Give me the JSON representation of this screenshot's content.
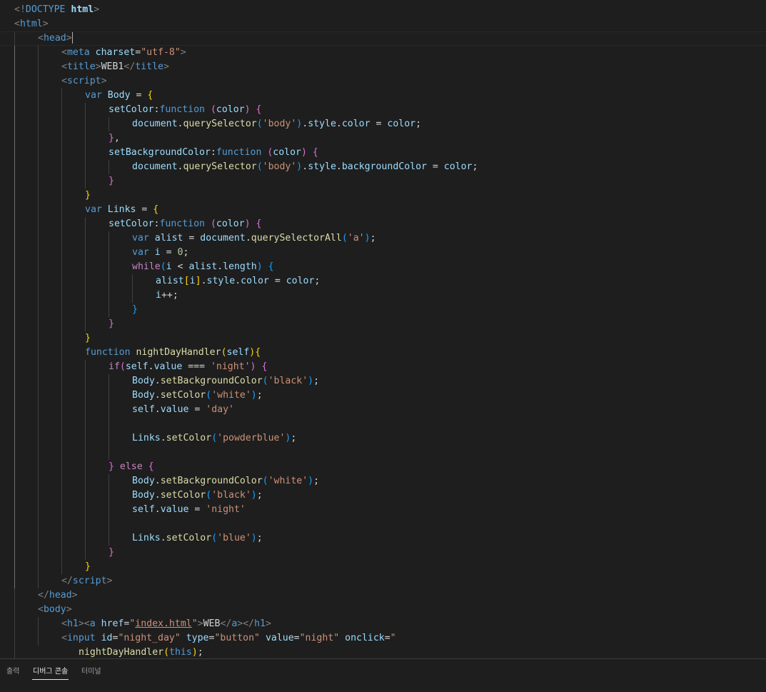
{
  "editor": {
    "lines": [
      {
        "indent": 0,
        "tokens": [
          [
            "t-punct",
            "<!"
          ],
          [
            "t-tag",
            "DOCTYPE "
          ],
          [
            "t-attr t-bold",
            "html"
          ],
          [
            "t-punct",
            ">"
          ]
        ]
      },
      {
        "indent": 0,
        "tokens": [
          [
            "t-punct",
            "<"
          ],
          [
            "t-tag",
            "html"
          ],
          [
            "t-punct",
            ">"
          ]
        ]
      },
      {
        "indent": 1,
        "current": true,
        "cursor": true,
        "tokens": [
          [
            "t-punct",
            "<"
          ],
          [
            "t-tag",
            "head"
          ],
          [
            "t-punct",
            ">"
          ]
        ]
      },
      {
        "indent": 2,
        "tokens": [
          [
            "t-punct",
            "<"
          ],
          [
            "t-tag",
            "meta "
          ],
          [
            "t-attr",
            "charset"
          ],
          [
            "t-text",
            "="
          ],
          [
            "t-str",
            "\"utf-8\""
          ],
          [
            "t-punct",
            ">"
          ]
        ]
      },
      {
        "indent": 2,
        "tokens": [
          [
            "t-punct",
            "<"
          ],
          [
            "t-tag",
            "title"
          ],
          [
            "t-punct",
            ">"
          ],
          [
            "t-text",
            "WEB1"
          ],
          [
            "t-punct",
            "</"
          ],
          [
            "t-tag",
            "title"
          ],
          [
            "t-punct",
            ">"
          ]
        ]
      },
      {
        "indent": 2,
        "tokens": [
          [
            "t-punct",
            "<"
          ],
          [
            "t-tag",
            "script"
          ],
          [
            "t-punct",
            ">"
          ]
        ]
      },
      {
        "indent": 3,
        "tokens": [
          [
            "t-kw",
            "var "
          ],
          [
            "t-var",
            "Body"
          ],
          [
            "t-text",
            " = "
          ],
          [
            "t-b1",
            "{"
          ]
        ]
      },
      {
        "indent": 4,
        "tokens": [
          [
            "t-var",
            "setColor"
          ],
          [
            "t-text",
            ":"
          ],
          [
            "t-kw",
            "function "
          ],
          [
            "t-b2",
            "("
          ],
          [
            "t-var",
            "color"
          ],
          [
            "t-b2",
            ")"
          ],
          [
            "t-text",
            " "
          ],
          [
            "t-b2",
            "{"
          ]
        ]
      },
      {
        "indent": 5,
        "tokens": [
          [
            "t-var",
            "document"
          ],
          [
            "t-text",
            "."
          ],
          [
            "t-fn",
            "querySelector"
          ],
          [
            "t-b3",
            "("
          ],
          [
            "t-str",
            "'body'"
          ],
          [
            "t-b3",
            ")"
          ],
          [
            "t-text",
            "."
          ],
          [
            "t-var",
            "style"
          ],
          [
            "t-text",
            "."
          ],
          [
            "t-var",
            "color"
          ],
          [
            "t-text",
            " = "
          ],
          [
            "t-var",
            "color"
          ],
          [
            "t-text",
            ";"
          ]
        ]
      },
      {
        "indent": 4,
        "tokens": [
          [
            "t-b2",
            "}"
          ],
          [
            "t-text",
            ","
          ]
        ]
      },
      {
        "indent": 4,
        "tokens": [
          [
            "t-var",
            "setBackgroundColor"
          ],
          [
            "t-text",
            ":"
          ],
          [
            "t-kw",
            "function "
          ],
          [
            "t-b2",
            "("
          ],
          [
            "t-var",
            "color"
          ],
          [
            "t-b2",
            ")"
          ],
          [
            "t-text",
            " "
          ],
          [
            "t-b2",
            "{"
          ]
        ]
      },
      {
        "indent": 5,
        "tokens": [
          [
            "t-var",
            "document"
          ],
          [
            "t-text",
            "."
          ],
          [
            "t-fn",
            "querySelector"
          ],
          [
            "t-b3",
            "("
          ],
          [
            "t-str",
            "'body'"
          ],
          [
            "t-b3",
            ")"
          ],
          [
            "t-text",
            "."
          ],
          [
            "t-var",
            "style"
          ],
          [
            "t-text",
            "."
          ],
          [
            "t-var",
            "backgroundColor"
          ],
          [
            "t-text",
            " = "
          ],
          [
            "t-var",
            "color"
          ],
          [
            "t-text",
            ";"
          ]
        ]
      },
      {
        "indent": 4,
        "tokens": [
          [
            "t-b2",
            "}"
          ]
        ]
      },
      {
        "indent": 3,
        "tokens": [
          [
            "t-b1",
            "}"
          ]
        ]
      },
      {
        "indent": 3,
        "tokens": [
          [
            "t-kw",
            "var "
          ],
          [
            "t-var",
            "Links"
          ],
          [
            "t-text",
            " = "
          ],
          [
            "t-b1",
            "{"
          ]
        ]
      },
      {
        "indent": 4,
        "tokens": [
          [
            "t-var",
            "setColor"
          ],
          [
            "t-text",
            ":"
          ],
          [
            "t-kw",
            "function "
          ],
          [
            "t-b2",
            "("
          ],
          [
            "t-var",
            "color"
          ],
          [
            "t-b2",
            ")"
          ],
          [
            "t-text",
            " "
          ],
          [
            "t-b2",
            "{"
          ]
        ]
      },
      {
        "indent": 5,
        "tokens": [
          [
            "t-kw",
            "var "
          ],
          [
            "t-var",
            "alist"
          ],
          [
            "t-text",
            " = "
          ],
          [
            "t-var",
            "document"
          ],
          [
            "t-text",
            "."
          ],
          [
            "t-fn",
            "querySelectorAll"
          ],
          [
            "t-b3",
            "("
          ],
          [
            "t-str",
            "'a'"
          ],
          [
            "t-b3",
            ")"
          ],
          [
            "t-text",
            ";"
          ]
        ]
      },
      {
        "indent": 5,
        "tokens": [
          [
            "t-kw",
            "var "
          ],
          [
            "t-var",
            "i"
          ],
          [
            "t-text",
            " = "
          ],
          [
            "t-num",
            "0"
          ],
          [
            "t-text",
            ";"
          ]
        ]
      },
      {
        "indent": 5,
        "tokens": [
          [
            "t-ctrl",
            "while"
          ],
          [
            "t-b3",
            "("
          ],
          [
            "t-var",
            "i"
          ],
          [
            "t-text",
            " < "
          ],
          [
            "t-var",
            "alist"
          ],
          [
            "t-text",
            "."
          ],
          [
            "t-var",
            "length"
          ],
          [
            "t-b3",
            ")"
          ],
          [
            "t-text",
            " "
          ],
          [
            "t-b3",
            "{"
          ]
        ]
      },
      {
        "indent": 6,
        "tokens": [
          [
            "t-var",
            "alist"
          ],
          [
            "t-b1",
            "["
          ],
          [
            "t-var",
            "i"
          ],
          [
            "t-b1",
            "]"
          ],
          [
            "t-text",
            "."
          ],
          [
            "t-var",
            "style"
          ],
          [
            "t-text",
            "."
          ],
          [
            "t-var",
            "color"
          ],
          [
            "t-text",
            " = "
          ],
          [
            "t-var",
            "color"
          ],
          [
            "t-text",
            ";"
          ]
        ]
      },
      {
        "indent": 6,
        "tokens": [
          [
            "t-var",
            "i"
          ],
          [
            "t-text",
            "++;"
          ]
        ]
      },
      {
        "indent": 5,
        "tokens": [
          [
            "t-b3",
            "}"
          ]
        ]
      },
      {
        "indent": 4,
        "tokens": [
          [
            "t-b2",
            "}"
          ]
        ]
      },
      {
        "indent": 3,
        "tokens": [
          [
            "t-b1",
            "}"
          ]
        ]
      },
      {
        "indent": 3,
        "tokens": [
          [
            "t-kw",
            "function "
          ],
          [
            "t-fn",
            "nightDayHandler"
          ],
          [
            "t-b1",
            "("
          ],
          [
            "t-var",
            "self"
          ],
          [
            "t-b1",
            ")"
          ],
          [
            "t-b1",
            "{"
          ]
        ]
      },
      {
        "indent": 4,
        "tokens": [
          [
            "t-ctrl",
            "if"
          ],
          [
            "t-b2",
            "("
          ],
          [
            "t-var",
            "self"
          ],
          [
            "t-text",
            "."
          ],
          [
            "t-var",
            "value"
          ],
          [
            "t-text",
            " === "
          ],
          [
            "t-str",
            "'night'"
          ],
          [
            "t-b2",
            ")"
          ],
          [
            "t-text",
            " "
          ],
          [
            "t-b2",
            "{"
          ]
        ]
      },
      {
        "indent": 5,
        "tokens": [
          [
            "t-var",
            "Body"
          ],
          [
            "t-text",
            "."
          ],
          [
            "t-fn",
            "setBackgroundColor"
          ],
          [
            "t-b3",
            "("
          ],
          [
            "t-str",
            "'black'"
          ],
          [
            "t-b3",
            ")"
          ],
          [
            "t-text",
            ";"
          ]
        ]
      },
      {
        "indent": 5,
        "tokens": [
          [
            "t-var",
            "Body"
          ],
          [
            "t-text",
            "."
          ],
          [
            "t-fn",
            "setColor"
          ],
          [
            "t-b3",
            "("
          ],
          [
            "t-str",
            "'white'"
          ],
          [
            "t-b3",
            ")"
          ],
          [
            "t-text",
            ";"
          ]
        ]
      },
      {
        "indent": 5,
        "tokens": [
          [
            "t-var",
            "self"
          ],
          [
            "t-text",
            "."
          ],
          [
            "t-var",
            "value"
          ],
          [
            "t-text",
            " = "
          ],
          [
            "t-str",
            "'day'"
          ]
        ]
      },
      {
        "indent": 5,
        "tokens": []
      },
      {
        "indent": 5,
        "tokens": [
          [
            "t-var",
            "Links"
          ],
          [
            "t-text",
            "."
          ],
          [
            "t-fn",
            "setColor"
          ],
          [
            "t-b3",
            "("
          ],
          [
            "t-str",
            "'powderblue'"
          ],
          [
            "t-b3",
            ")"
          ],
          [
            "t-text",
            ";"
          ]
        ]
      },
      {
        "indent": 5,
        "tokens": []
      },
      {
        "indent": 4,
        "tokens": [
          [
            "t-b2",
            "}"
          ],
          [
            "t-text",
            " "
          ],
          [
            "t-ctrl",
            "else"
          ],
          [
            "t-text",
            " "
          ],
          [
            "t-b2",
            "{"
          ]
        ]
      },
      {
        "indent": 5,
        "tokens": [
          [
            "t-var",
            "Body"
          ],
          [
            "t-text",
            "."
          ],
          [
            "t-fn",
            "setBackgroundColor"
          ],
          [
            "t-b3",
            "("
          ],
          [
            "t-str",
            "'white'"
          ],
          [
            "t-b3",
            ")"
          ],
          [
            "t-text",
            ";"
          ]
        ]
      },
      {
        "indent": 5,
        "tokens": [
          [
            "t-var",
            "Body"
          ],
          [
            "t-text",
            "."
          ],
          [
            "t-fn",
            "setColor"
          ],
          [
            "t-b3",
            "("
          ],
          [
            "t-str",
            "'black'"
          ],
          [
            "t-b3",
            ")"
          ],
          [
            "t-text",
            ";"
          ]
        ]
      },
      {
        "indent": 5,
        "tokens": [
          [
            "t-var",
            "self"
          ],
          [
            "t-text",
            "."
          ],
          [
            "t-var",
            "value"
          ],
          [
            "t-text",
            " = "
          ],
          [
            "t-str",
            "'night'"
          ]
        ]
      },
      {
        "indent": 5,
        "tokens": []
      },
      {
        "indent": 5,
        "tokens": [
          [
            "t-var",
            "Links"
          ],
          [
            "t-text",
            "."
          ],
          [
            "t-fn",
            "setColor"
          ],
          [
            "t-b3",
            "("
          ],
          [
            "t-str",
            "'blue'"
          ],
          [
            "t-b3",
            ")"
          ],
          [
            "t-text",
            ";"
          ]
        ]
      },
      {
        "indent": 4,
        "tokens": [
          [
            "t-b2",
            "}"
          ]
        ]
      },
      {
        "indent": 3,
        "tokens": [
          [
            "t-b1",
            "}"
          ]
        ]
      },
      {
        "indent": 2,
        "tokens": [
          [
            "t-punct",
            "</"
          ],
          [
            "t-tag",
            "script"
          ],
          [
            "t-punct",
            ">"
          ]
        ]
      },
      {
        "indent": 1,
        "tokens": [
          [
            "t-punct",
            "</"
          ],
          [
            "t-tag",
            "head"
          ],
          [
            "t-punct",
            ">"
          ]
        ]
      },
      {
        "indent": 1,
        "tokens": [
          [
            "t-punct",
            "<"
          ],
          [
            "t-tag",
            "body"
          ],
          [
            "t-punct",
            ">"
          ]
        ]
      },
      {
        "indent": 2,
        "tokens": [
          [
            "t-punct",
            "<"
          ],
          [
            "t-tag",
            "h1"
          ],
          [
            "t-punct",
            "><"
          ],
          [
            "t-tag",
            "a "
          ],
          [
            "t-attr",
            "href"
          ],
          [
            "t-text",
            "="
          ],
          [
            "t-str",
            "\""
          ],
          [
            "t-link",
            "index.html"
          ],
          [
            "t-str",
            "\""
          ],
          [
            "t-punct",
            ">"
          ],
          [
            "t-text",
            "WEB"
          ],
          [
            "t-punct",
            "</"
          ],
          [
            "t-tag",
            "a"
          ],
          [
            "t-punct",
            "></"
          ],
          [
            "t-tag",
            "h1"
          ],
          [
            "t-punct",
            ">"
          ]
        ]
      },
      {
        "indent": 2,
        "tokens": [
          [
            "t-punct",
            "<"
          ],
          [
            "t-tag",
            "input "
          ],
          [
            "t-attr",
            "id"
          ],
          [
            "t-text",
            "="
          ],
          [
            "t-str",
            "\"night_day\""
          ],
          [
            "t-text",
            " "
          ],
          [
            "t-attr",
            "type"
          ],
          [
            "t-text",
            "="
          ],
          [
            "t-str",
            "\"button\""
          ],
          [
            "t-text",
            " "
          ],
          [
            "t-attr",
            "value"
          ],
          [
            "t-text",
            "="
          ],
          [
            "t-str",
            "\"night\""
          ],
          [
            "t-text",
            " "
          ],
          [
            "t-attr",
            "onclick"
          ],
          [
            "t-text",
            "="
          ],
          [
            "t-str",
            "\""
          ]
        ]
      },
      {
        "indent": 2,
        "wrapped": true,
        "tokens": [
          [
            "t-fn",
            "nightDayHandler"
          ],
          [
            "t-b1",
            "("
          ],
          [
            "t-kw",
            "this"
          ],
          [
            "t-b1",
            ")"
          ],
          [
            "t-text",
            ";"
          ]
        ]
      }
    ]
  },
  "panel": {
    "tabs": [
      {
        "label": "출력",
        "active": false
      },
      {
        "label": "디버그 콘솔",
        "active": true
      },
      {
        "label": "터미널",
        "active": false
      }
    ]
  }
}
